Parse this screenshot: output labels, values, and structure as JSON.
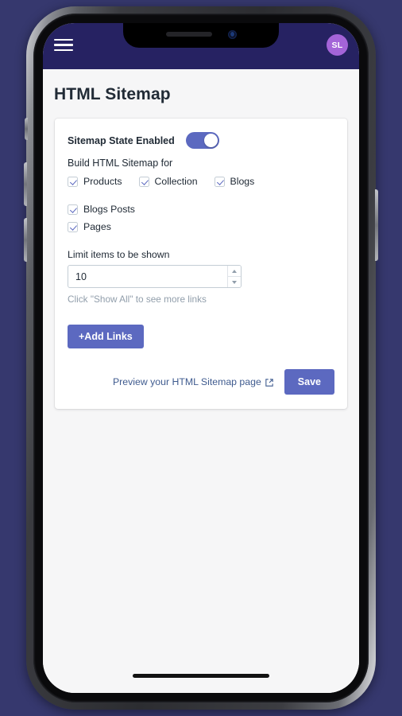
{
  "appbar": {
    "menu_icon": "hamburger-menu-icon",
    "avatar_initials": "SL",
    "background_color": "#262262",
    "avatar_color": "#a464d8"
  },
  "page": {
    "title": "HTML Sitemap",
    "background_color": "#f6f6f7"
  },
  "card": {
    "state_label": "Sitemap State Enabled",
    "toggle_on": true,
    "subtitle": "Build HTML Sitemap for",
    "checkboxes": [
      {
        "label": "Products",
        "checked": true
      },
      {
        "label": "Collection",
        "checked": true
      },
      {
        "label": "Blogs",
        "checked": true
      },
      {
        "label": "Blogs Posts",
        "checked": true
      },
      {
        "label": "Pages",
        "checked": true
      }
    ],
    "limit_field": {
      "label": "Limit items to be shown",
      "value": "10",
      "placeholder": "10",
      "hint": "Click \"Show All\" to see more links"
    },
    "add_links_label": "+Add Links",
    "preview_link_label": "Preview your HTML Sitemap page",
    "preview_link_icon": "external-link-icon",
    "save_label": "Save",
    "accent_color": "#5c69c0",
    "link_color": "#3f5b8f"
  },
  "device": {
    "frame": "iphone-x-style-mockup",
    "background_color": "#36386e"
  }
}
